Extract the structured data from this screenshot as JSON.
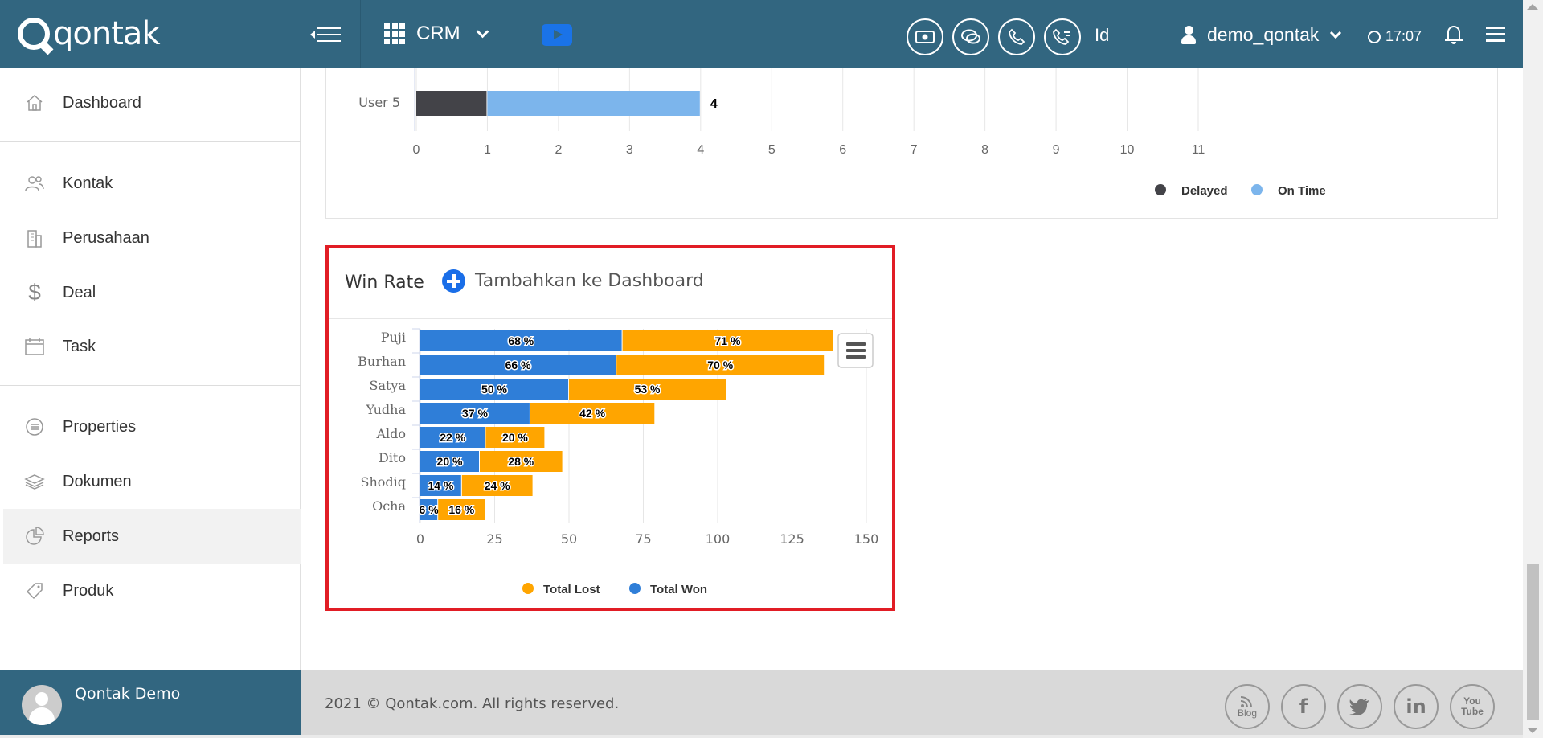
{
  "topbar": {
    "logo_text": "qontak",
    "module": "CRM",
    "language": "Id",
    "username": "demo_qontak",
    "time": "17:07",
    "bg_color": "#326680"
  },
  "sidebar": {
    "items": [
      {
        "label": "Dashboard",
        "icon": "home-icon"
      },
      {
        "label": "Kontak",
        "icon": "contacts-icon"
      },
      {
        "label": "Perusahaan",
        "icon": "building-icon"
      },
      {
        "label": "Deal",
        "icon": "dollar-icon"
      },
      {
        "label": "Task",
        "icon": "calendar-icon"
      },
      {
        "label": "Properties",
        "icon": "list-icon"
      },
      {
        "label": "Dokumen",
        "icon": "layers-icon"
      },
      {
        "label": "Reports",
        "icon": "pie-chart-icon"
      },
      {
        "label": "Produk",
        "icon": "tag-icon"
      }
    ],
    "profile_name": "Qontak Demo"
  },
  "top_chart": {
    "category": "User 5",
    "total_label": "4",
    "legend": [
      "Delayed",
      "On Time"
    ]
  },
  "win_rate": {
    "title": "Win Rate",
    "add_to_dashboard": "Tambahkan ke Dashboard"
  },
  "chart_data": [
    {
      "type": "bar",
      "orientation": "horizontal",
      "stacked": true,
      "categories": [
        "User 5"
      ],
      "series": [
        {
          "name": "Delayed",
          "values": [
            1
          ],
          "color": "#434348"
        },
        {
          "name": "On Time",
          "values": [
            3
          ],
          "color": "#7cb5ec"
        }
      ],
      "totals": [
        4
      ],
      "xticks": [
        "0",
        "1",
        "2",
        "3",
        "4",
        "5",
        "6",
        "7",
        "8",
        "9",
        "10",
        "11"
      ],
      "xlim": [
        0,
        11
      ],
      "grid": true,
      "legend_position": "bottom"
    },
    {
      "type": "bar",
      "orientation": "horizontal",
      "stacked": true,
      "categories": [
        "Puji",
        "Burhan",
        "Satya",
        "Yudha",
        "Aldo",
        "Dito",
        "Shodiq",
        "Ocha"
      ],
      "series": [
        {
          "name": "Total Won",
          "values": [
            68,
            66,
            50,
            37,
            22,
            20,
            14,
            6
          ],
          "labels": [
            "68 %",
            "66 %",
            "50 %",
            "37 %",
            "22 %",
            "20 %",
            "14 %",
            "6 %"
          ],
          "color": "#2f7ed8"
        },
        {
          "name": "Total Lost",
          "values": [
            71,
            70,
            53,
            42,
            20,
            28,
            24,
            16
          ],
          "labels": [
            "71 %",
            "70 %",
            "53 %",
            "42 %",
            "20 %",
            "28 %",
            "24 %",
            "16 %"
          ],
          "color": "#ffa500"
        }
      ],
      "xticks": [
        "0",
        "25",
        "50",
        "75",
        "100",
        "125",
        "150"
      ],
      "xlim": [
        0,
        150
      ],
      "grid": true,
      "legend": [
        "Total Lost",
        "Total Won"
      ],
      "legend_position": "bottom"
    }
  ],
  "footer": {
    "copyright": "2021 © Qontak.com. All rights reserved.",
    "social": [
      {
        "label": "Blog",
        "icon": "rss-icon"
      },
      {
        "label": "f",
        "icon": "facebook-icon"
      },
      {
        "label": "",
        "icon": "twitter-icon"
      },
      {
        "label": "in",
        "icon": "linkedin-icon"
      },
      {
        "label": "You Tube",
        "icon": "youtube-icon"
      }
    ]
  }
}
